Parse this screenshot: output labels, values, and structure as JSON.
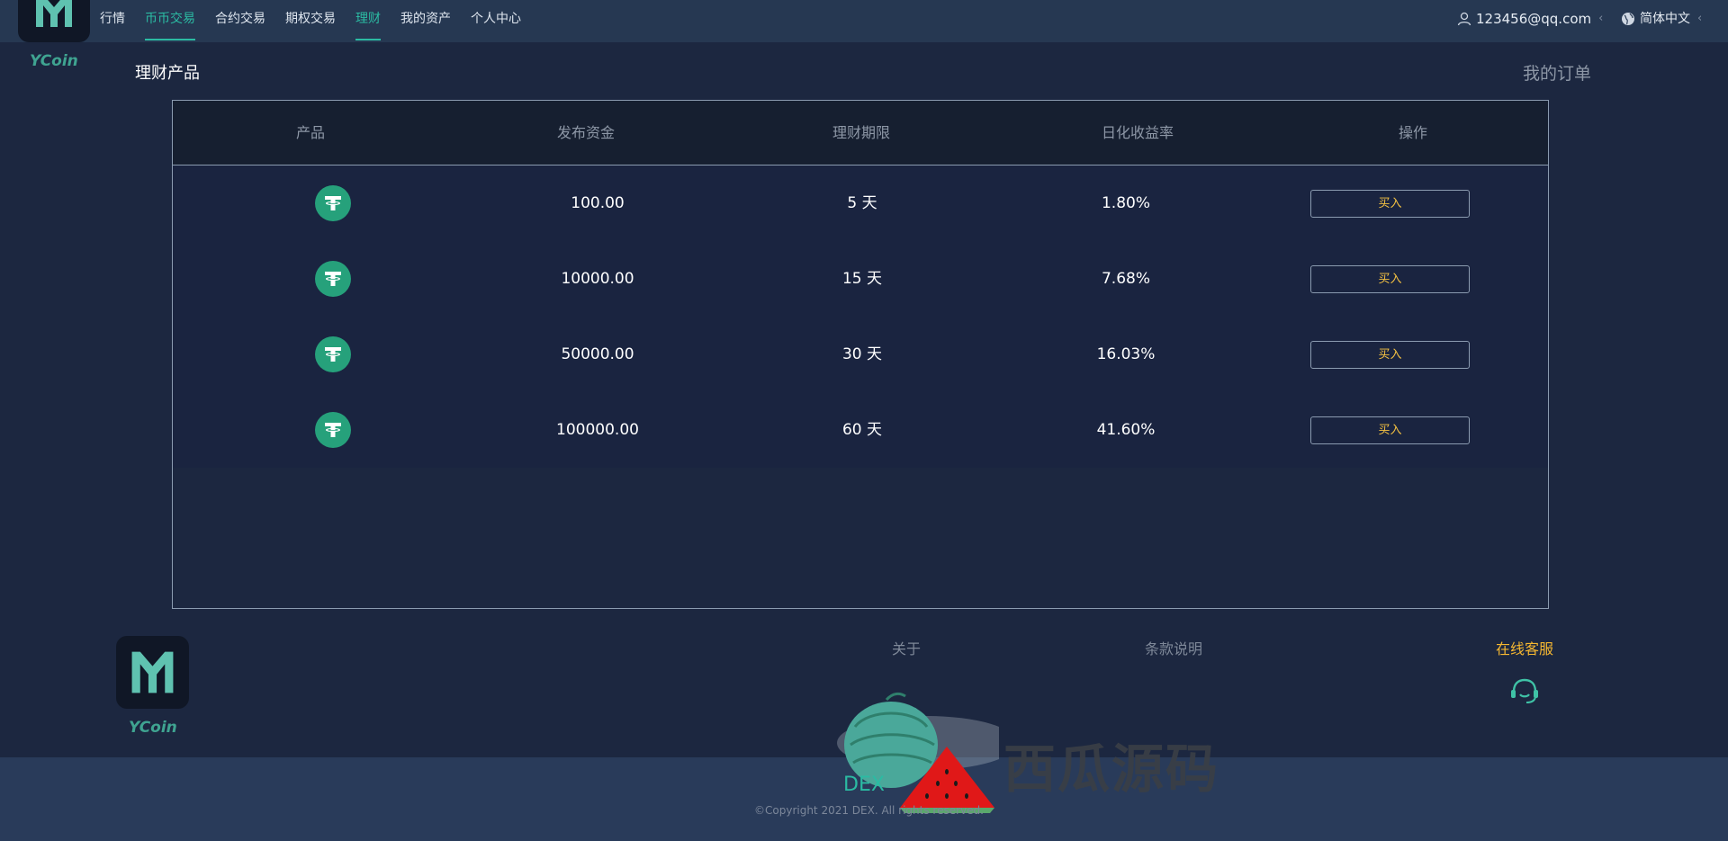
{
  "brand": {
    "name": "YCoin"
  },
  "nav": {
    "items": [
      {
        "label": "行情",
        "active": false
      },
      {
        "label": "币币交易",
        "active": true
      },
      {
        "label": "合约交易",
        "active": false
      },
      {
        "label": "期权交易",
        "active": false
      },
      {
        "label": "理财",
        "active": true
      },
      {
        "label": "我的资产",
        "active": false
      },
      {
        "label": "个人中心",
        "active": false
      }
    ]
  },
  "header": {
    "user_email": "123456@qq.com",
    "language": "简体中文"
  },
  "section": {
    "title": "理财产品",
    "orders_link": "我的订单"
  },
  "table": {
    "columns": [
      "产品",
      "发布资金",
      "理财期限",
      "日化收益率",
      "操作"
    ],
    "rows": [
      {
        "product_icon": "tether-icon",
        "amount": "100.00",
        "term": "5 天",
        "rate": "1.80%",
        "action": "买入"
      },
      {
        "product_icon": "tether-icon",
        "amount": "10000.00",
        "term": "15 天",
        "rate": "7.68%",
        "action": "买入"
      },
      {
        "product_icon": "tether-icon",
        "amount": "50000.00",
        "term": "30 天",
        "rate": "16.03%",
        "action": "买入"
      },
      {
        "product_icon": "tether-icon",
        "amount": "100000.00",
        "term": "60 天",
        "rate": "41.60%",
        "action": "买入"
      }
    ]
  },
  "footer": {
    "about": "关于",
    "terms": "条款说明",
    "service": "在线客服",
    "dex": "DEX",
    "copyright": "©Copyright 2021 DEX. All rights reserved.",
    "watermark": "西瓜源码"
  },
  "colors": {
    "accent": "#2bbba3",
    "buy": "#f5c242",
    "service": "#f5b731",
    "tether": "#26a17b"
  }
}
